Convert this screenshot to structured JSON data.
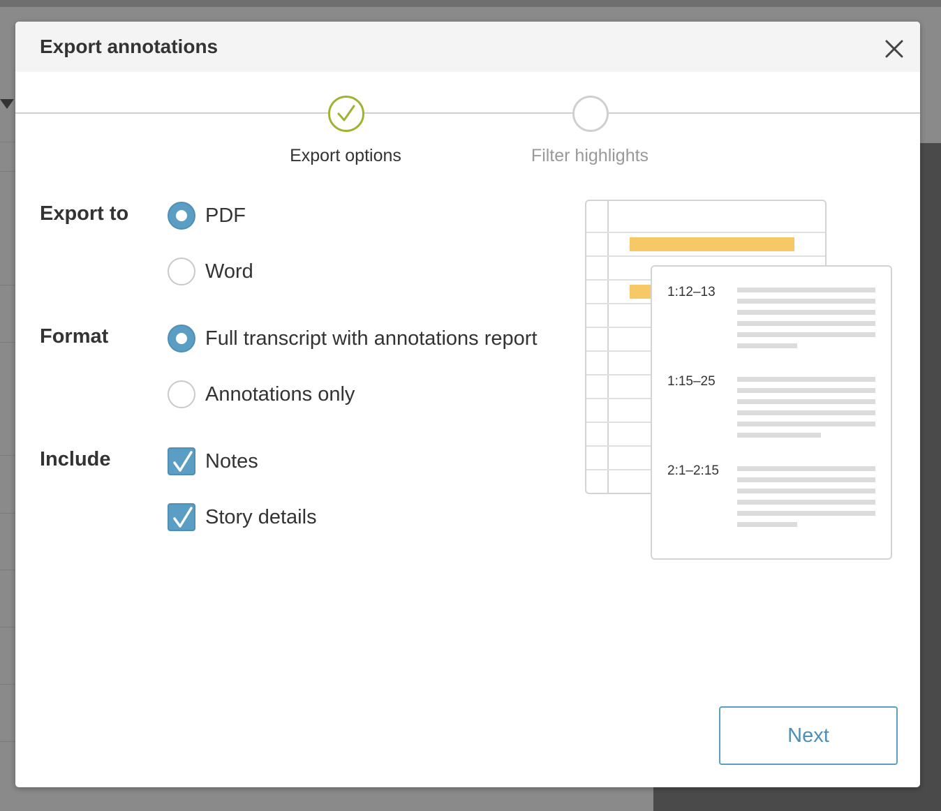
{
  "modal": {
    "title": "Export annotations",
    "steps": [
      {
        "label": "Export options",
        "state": "done"
      },
      {
        "label": "Filter highlights",
        "state": "todo"
      }
    ],
    "export_to": {
      "label": "Export to",
      "options": [
        {
          "label": "PDF",
          "selected": true
        },
        {
          "label": "Word",
          "selected": false
        }
      ]
    },
    "format": {
      "label": "Format",
      "options": [
        {
          "label": "Full transcript with annotations report",
          "selected": true
        },
        {
          "label": "Annotations only",
          "selected": false
        }
      ]
    },
    "include": {
      "label": "Include",
      "options": [
        {
          "label": "Notes",
          "checked": true
        },
        {
          "label": "Story details",
          "checked": true
        }
      ]
    },
    "preview": {
      "references": [
        "1:12–13",
        "1:15–25",
        "2:1–2:15"
      ]
    },
    "next_label": "Next"
  },
  "colors": {
    "accent_blue": "#5b9ec4",
    "step_done_green": "#9bb530",
    "highlight_yellow": "#f7c966"
  }
}
